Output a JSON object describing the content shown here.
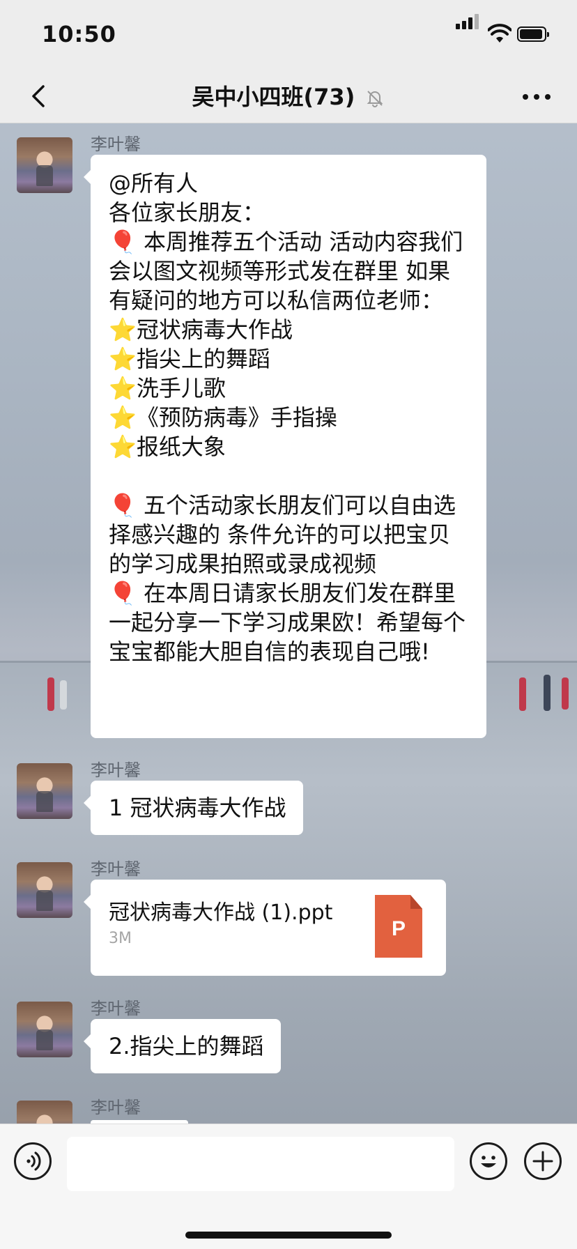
{
  "status_bar": {
    "time": "10:50"
  },
  "nav": {
    "title": "吴中小四班(73)"
  },
  "messages": [
    {
      "sender": "李叶馨",
      "text": "@所有人\n各位家长朋友：\n🎈 本周推荐五个活动 活动内容我们会以图文视频等形式发在群里 如果有疑问的地方可以私信两位老师：\n⭐冠状病毒大作战\n⭐指尖上的舞蹈\n⭐洗手儿歌\n⭐《预防病毒》手指操\n⭐报纸大象\n\n🎈 五个活动家长朋友们可以自由选择感兴趣的 条件允许的可以把宝贝的学习成果拍照或录成视频\n🎈 在本周日请家长朋友们发在群里一起分享一下学习成果欧！希望每个宝宝都能大胆自信的表现自己哦!"
    },
    {
      "sender": "李叶馨",
      "text": "1 冠状病毒大作战"
    },
    {
      "sender": "李叶馨",
      "file": {
        "name": "冠状病毒大作战 (1).ppt",
        "size": "3M",
        "icon_label": "P",
        "icon_color": "#e2613f"
      }
    },
    {
      "sender": "李叶馨",
      "text": "2.指尖上的舞蹈"
    },
    {
      "sender": "李叶馨"
    }
  ],
  "input_bar": {
    "placeholder": ""
  },
  "icons": {
    "back": "chevron-left-icon",
    "mute": "bell-muted-icon",
    "more": "more-dots-icon",
    "voice": "voice-icon",
    "emoji": "emoji-icon",
    "plus": "plus-icon"
  }
}
